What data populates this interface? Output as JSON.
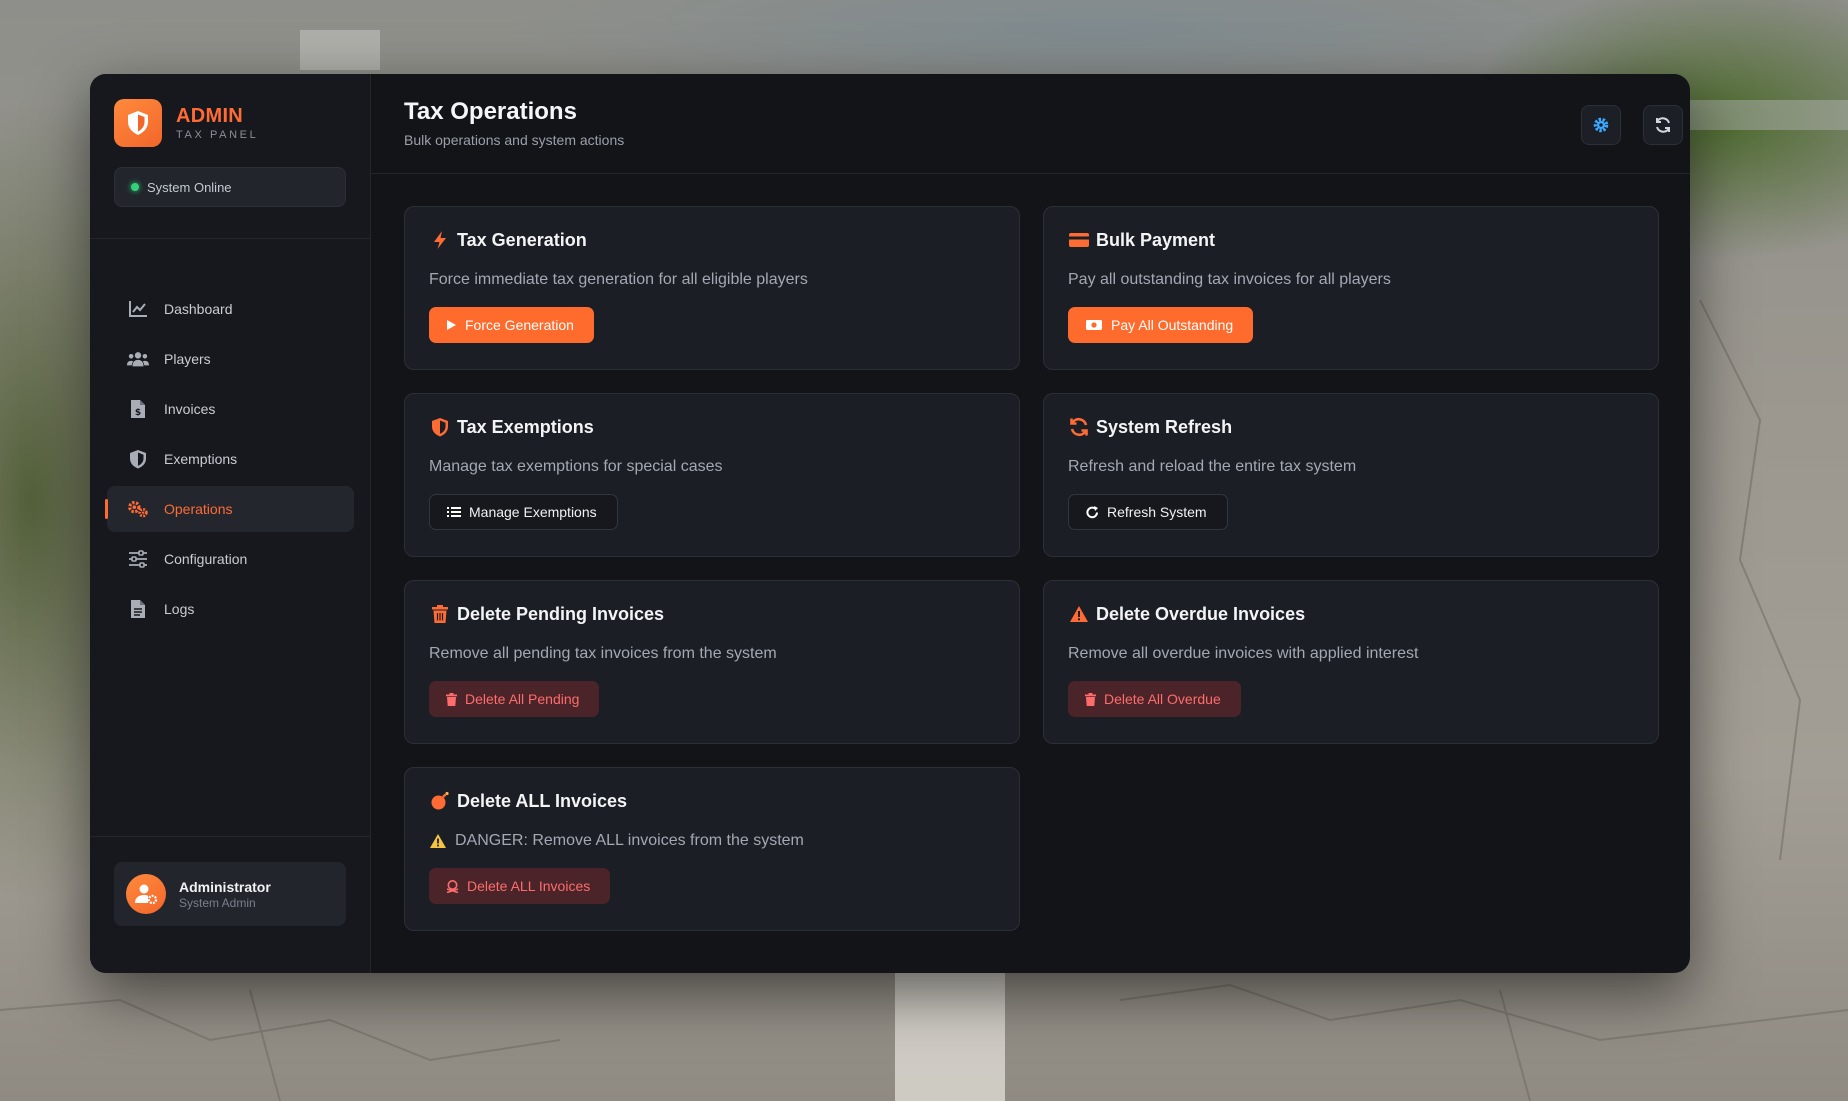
{
  "brand": {
    "title": "ADMIN",
    "subtitle": "TAX PANEL"
  },
  "status": {
    "label": "System Online",
    "color": "#33d17a"
  },
  "sidebar": {
    "items": [
      {
        "label": "Dashboard",
        "icon": "chart-line-icon",
        "active": false
      },
      {
        "label": "Players",
        "icon": "users-icon",
        "active": false
      },
      {
        "label": "Invoices",
        "icon": "invoice-icon",
        "active": false
      },
      {
        "label": "Exemptions",
        "icon": "shield-icon",
        "active": false
      },
      {
        "label": "Operations",
        "icon": "cogs-icon",
        "active": true
      },
      {
        "label": "Configuration",
        "icon": "sliders-icon",
        "active": false
      },
      {
        "label": "Logs",
        "icon": "file-icon",
        "active": false
      }
    ]
  },
  "user": {
    "name": "Administrator",
    "role": "System Admin"
  },
  "header": {
    "title": "Tax Operations",
    "subtitle": "Bulk operations and system actions",
    "buttons": [
      "settings-icon",
      "refresh-icon",
      "close-icon"
    ]
  },
  "cards": [
    {
      "title": "Tax Generation",
      "icon": "bolt-icon",
      "description": "Force immediate tax generation for all eligible players",
      "button": "Force Generation",
      "button_icon": "play-icon",
      "style": "primary"
    },
    {
      "title": "Bulk Payment",
      "icon": "credit-card-icon",
      "description": "Pay all outstanding tax invoices for all players",
      "button": "Pay All Outstanding",
      "button_icon": "money-icon",
      "style": "primary"
    },
    {
      "title": "Tax Exemptions",
      "icon": "shield-icon",
      "description": "Manage tax exemptions for special cases",
      "button": "Manage Exemptions",
      "button_icon": "list-icon",
      "style": "outline"
    },
    {
      "title": "System Refresh",
      "icon": "sync-icon",
      "description": "Refresh and reload the entire tax system",
      "button": "Refresh System",
      "button_icon": "redo-icon",
      "style": "outline"
    },
    {
      "title": "Delete Pending Invoices",
      "icon": "trash-icon",
      "description": "Remove all pending tax invoices from the system",
      "button": "Delete All Pending",
      "button_icon": "trash-icon",
      "style": "danger"
    },
    {
      "title": "Delete Overdue Invoices",
      "icon": "warning-icon",
      "description": "Remove all overdue invoices with applied interest",
      "button": "Delete All Overdue",
      "button_icon": "trash-icon",
      "style": "danger"
    },
    {
      "title": "Delete ALL Invoices",
      "icon": "bomb-icon",
      "description": "DANGER: Remove ALL invoices from the system",
      "button": "Delete ALL Invoices",
      "button_icon": "skull-icon",
      "style": "danger"
    }
  ],
  "colors": {
    "accent": "#ff6b35",
    "danger_text": "#ff6c6c",
    "danger_bg": "#4a2428",
    "settings_icon": "#3aa8ff"
  }
}
